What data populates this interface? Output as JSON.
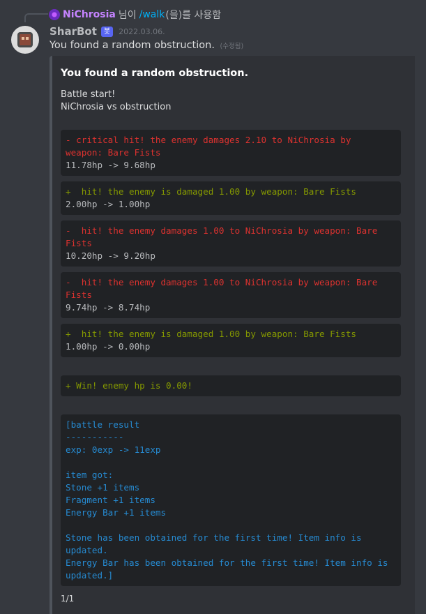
{
  "reply": {
    "username": "NiChrosia",
    "suffix_1": "님이",
    "command": "/walk",
    "suffix_2": "(을)를 사용함"
  },
  "message": {
    "author": "SharBot",
    "bot_tag": "봇",
    "timestamp": "2022.03.06.",
    "content": "You found a random obstruction.",
    "edited": "(수정됨)"
  },
  "embed": {
    "title": "You found a random obstruction.",
    "desc_line1": "Battle start!",
    "desc_line2": "NiChrosia vs obstruction",
    "blocks": [
      {
        "line1": "- critical hit! the enemy damages 2.10 to NiChrosia by",
        "line2": "weapon: Bare Fists",
        "line3": "11.78hp -> 9.68hp"
      },
      {
        "line1": "+  hit! the enemy is damaged 1.00 by weapon: Bare Fists",
        "line2": "2.00hp -> 1.00hp"
      },
      {
        "line1": "-  hit! the enemy damages 1.00 to NiChrosia by weapon: Bare",
        "line2": "Fists",
        "line3": "10.20hp -> 9.20hp"
      },
      {
        "line1": "-  hit! the enemy damages 1.00 to NiChrosia by weapon: Bare",
        "line2": "Fists",
        "line3": "9.74hp -> 8.74hp"
      },
      {
        "line1": "+  hit! the enemy is damaged 1.00 by weapon: Bare Fists",
        "line2": "1.00hp -> 0.00hp"
      }
    ],
    "win": "+ Win! enemy hp is 0.00!",
    "result": {
      "l1": "[battle result",
      "l2": "-----------",
      "l3": "exp: 0exp -> 11exp",
      "l4": "",
      "l5": "item got:",
      "l6": "Stone +1 items",
      "l7": "Fragment +1 items",
      "l8": "Energy Bar +1 items",
      "l9": "",
      "l10": "Stone has been obtained for the first time! Item info is",
      "l11": "updated.",
      "l12": "Energy Bar has been obtained for the first time! Item info is",
      "l13": "updated.]"
    },
    "footer": "1/1"
  },
  "colors": {
    "background": "#36393f",
    "embed_background": "#2f3136",
    "code_background": "#202225",
    "damage_red": "#dc322f",
    "hit_green": "#859900",
    "result_blue": "#268bd2",
    "command_link": "#00aff4",
    "bot_tag": "#5865f2"
  }
}
